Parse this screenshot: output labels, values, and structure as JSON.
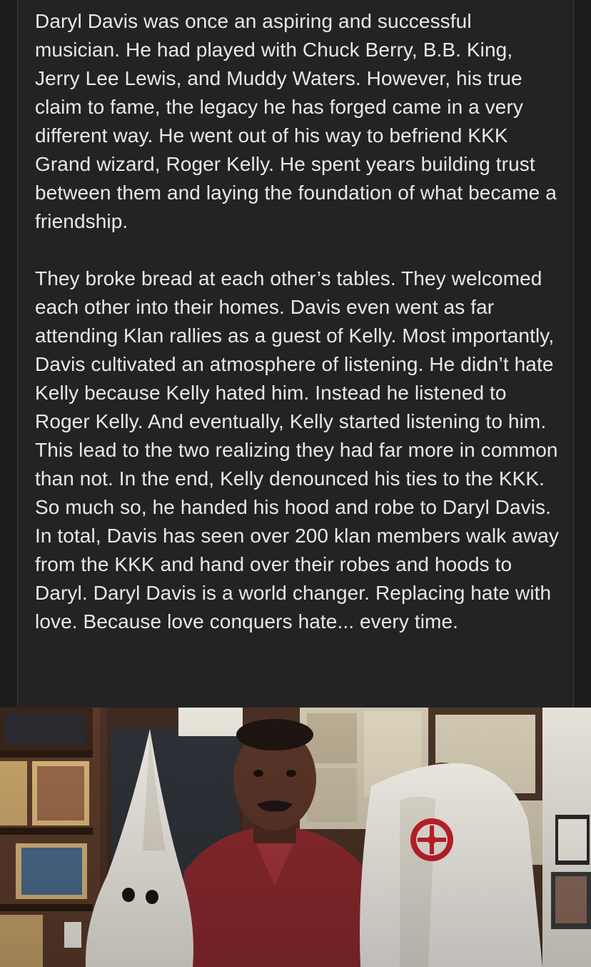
{
  "post": {
    "paragraphs": [
      "Daryl Davis was once an aspiring and successful musician. He had played with Chuck Berry, B.B. King, Jerry Lee Lewis, and Muddy Waters. However, his true claim to fame, the legacy he has forged came in a very different way. He went out of his way to befriend KKK Grand wizard, Roger Kelly. He spent years building trust between them and laying the foundation of what became a friendship.",
      "They broke bread at each other’s tables. They welcomed each other into their homes. Davis even went as far attending Klan rallies as a guest of Kelly. Most importantly, Davis cultivated an atmosphere of listening. He didn’t hate Kelly because Kelly hated him. Instead he listened to Roger Kelly. And eventually, Kelly started listening to him. This lead to the two realizing they had far more in common than not. In the end, Kelly denounced his ties to the KKK. So much so, he handed his hood and robe to Daryl Davis. In total, Davis has seen over 200 klan members walk away from the KKK and hand over their robes and hoods to Daryl. Daryl Davis is a world changer. Replacing hate with love. Because love conquers hate... every time."
    ]
  },
  "photo": {
    "description_hidden": ""
  },
  "colors": {
    "background": "#1c1c1e",
    "card": "#232325",
    "text": "#e8e8ea"
  }
}
